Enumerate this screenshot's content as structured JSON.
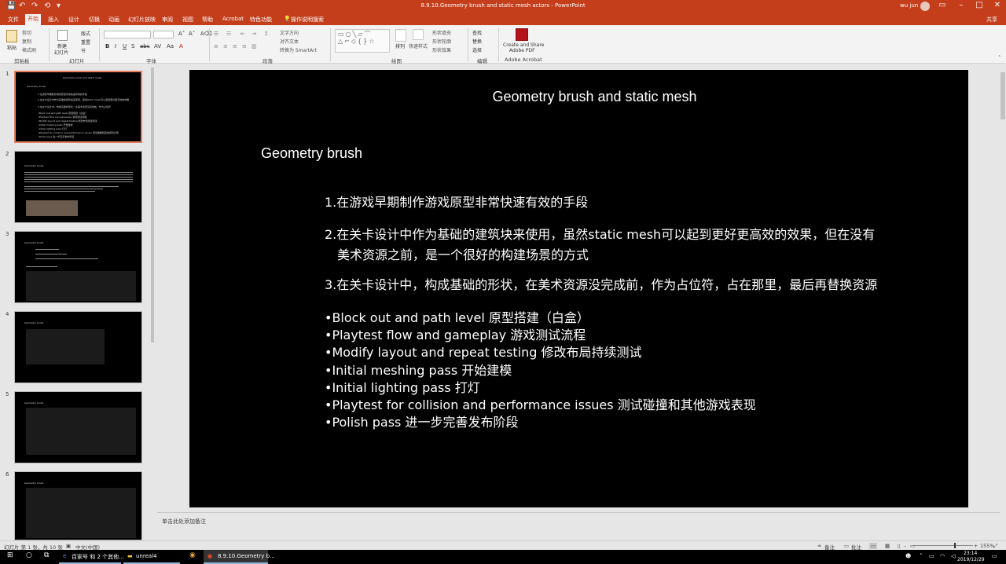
{
  "window": {
    "title": "8.9.10.Geometry brush  and static mesh actors  -  PowerPoint",
    "user": "wu jun",
    "quick_access": [
      "💾",
      "↶",
      "↷",
      "⟲",
      "▾"
    ]
  },
  "menu": {
    "tabs": [
      "文件",
      "开始",
      "插入",
      "设计",
      "切换",
      "动画",
      "幻灯片放映",
      "审阅",
      "视图",
      "帮助",
      "Acrobat",
      "特色功能",
      "操作说明搜索"
    ],
    "active_tab": "开始",
    "share": "共享"
  },
  "ribbon": {
    "groups": {
      "clipboard": "剪贴板",
      "slides": "幻灯片",
      "font": "字体",
      "paragraph": "段落",
      "drawing": "绘图",
      "editing": "编辑",
      "acrobat": "Adobe Acrobat"
    },
    "clipboard": {
      "paste": "粘贴",
      "cut": "剪切",
      "copy": "复制",
      "format_painter": "格式刷"
    },
    "slides": {
      "new_slide": "新建",
      "new_slide2": "幻灯片",
      "layout": "版式",
      "reset": "重置",
      "section": "节"
    },
    "paragraph": {
      "text_direction": "文字方向",
      "align_text": "对齐文本",
      "smartart": "转换为 SmartArt"
    },
    "drawing": {
      "arrange": "排列",
      "quick_styles": "快速样式",
      "shape_fill": "形状填充",
      "shape_outline": "形状轮廓",
      "shape_effects": "形状效果"
    },
    "editing": {
      "find": "查找",
      "replace": "替换",
      "select": "选择"
    },
    "acrobat": {
      "create_pdf": "Create and Share",
      "create_pdf2": "Adobe PDF"
    }
  },
  "thumbnails": {
    "numbers": [
      "1",
      "2",
      "3",
      "4",
      "5",
      "6"
    ],
    "slide1": {
      "title": "Geometry brush and static mesh",
      "sub": "Geometry brush",
      "lines": [
        "1.在游戏早期制作游戏原型非常快速有效的手段",
        "2.在关卡设计中作为基础的建筑块来使用，虽然static mesh可以起到更好更高效的效果",
        "3.在关卡设计中，构成基础的形状，在美术资源没完成前，作为占位符",
        "•Block out and path level    原型搭建（白盒）",
        "•Playtest flow and gameplay    游戏测试流程",
        "•Modify layout and repeat testing   修改布局持续测试",
        "•Initial meshing pass      开始建模",
        "•Initial lighting pass      打灯",
        "•Playtest for collision and performance issues   测试碰撞和其他游戏表现",
        "•Polish pass   进一步完善发布阶段"
      ]
    },
    "other_title": "Geometry brush"
  },
  "slide": {
    "title": "Geometry brush and static mesh",
    "subtitle": "Geometry brush",
    "p1": "1.在游戏早期制作游戏原型非常快速有效的手段",
    "p2a": "2.在关卡设计中作为基础的建筑块来使用，虽然static mesh可以起到更好更高效的效果，但在没有",
    "p2b": "美术资源之前，是一个很好的构建场景的方式",
    "p3": "3.在关卡设计中，构成基础的形状，在美术资源没完成前，作为占位符，占在那里，最后再替换资源",
    "bullets": [
      "•Block out and path level    原型搭建（白盒）",
      "•Playtest flow and gameplay    游戏测试流程",
      "•Modify layout and repeat testing    修改布局持续测试",
      "•Initial meshing pass      开始建模",
      "•Initial lighting pass       打灯",
      "•Playtest for collision and performance issues    测试碰撞和其他游戏表现",
      "•Polish pass    进一步完善发布阶段"
    ]
  },
  "notes": {
    "placeholder": "单击此处添加备注"
  },
  "status": {
    "slide_info": "幻灯片 第 1 张，共 10 张",
    "language": "中文(中国)",
    "notes": "备注",
    "comments": "批注",
    "zoom": "155%"
  },
  "taskbar": {
    "apps": [
      "百家号 和 2 个其他...",
      "unreal4",
      "8.9.10.Geometry b..."
    ],
    "time": "23:14",
    "date": "2019/12/29"
  }
}
